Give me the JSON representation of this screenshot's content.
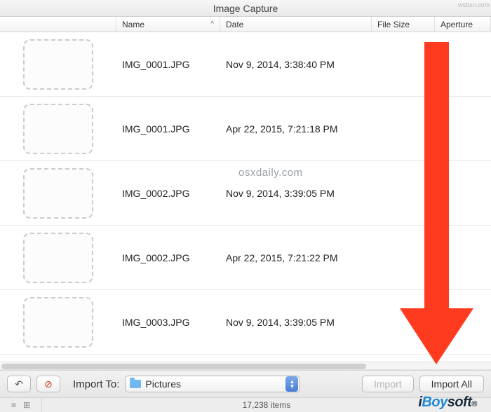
{
  "window": {
    "title": "Image Capture"
  },
  "columns": {
    "name": "Name",
    "date": "Date",
    "size": "File Size",
    "aperture": "Aperture",
    "sort_indicator": "^"
  },
  "rows": [
    {
      "name": "IMG_0001.JPG",
      "date": "Nov 9, 2014, 3:38:40 PM"
    },
    {
      "name": "IMG_0001.JPG",
      "date": "Apr 22, 2015, 7:21:18 PM"
    },
    {
      "name": "IMG_0002.JPG",
      "date": "Nov 9, 2014, 3:39:05 PM"
    },
    {
      "name": "IMG_0002.JPG",
      "date": "Apr 22, 2015, 7:21:22 PM"
    },
    {
      "name": "IMG_0003.JPG",
      "date": "Nov 9, 2014, 3:39:05 PM"
    }
  ],
  "watermark_site": "osxdaily.com",
  "toolbar": {
    "import_to_label": "Import To:",
    "destination": "Pictures",
    "import_label": "Import",
    "import_all_label": "Import All"
  },
  "status": {
    "items": "17,238 items"
  },
  "branding": {
    "logo_i": "i",
    "logo_boy": "Boy",
    "logo_soft": "soft",
    "reg": "®"
  },
  "corner": "wsbxn.com"
}
